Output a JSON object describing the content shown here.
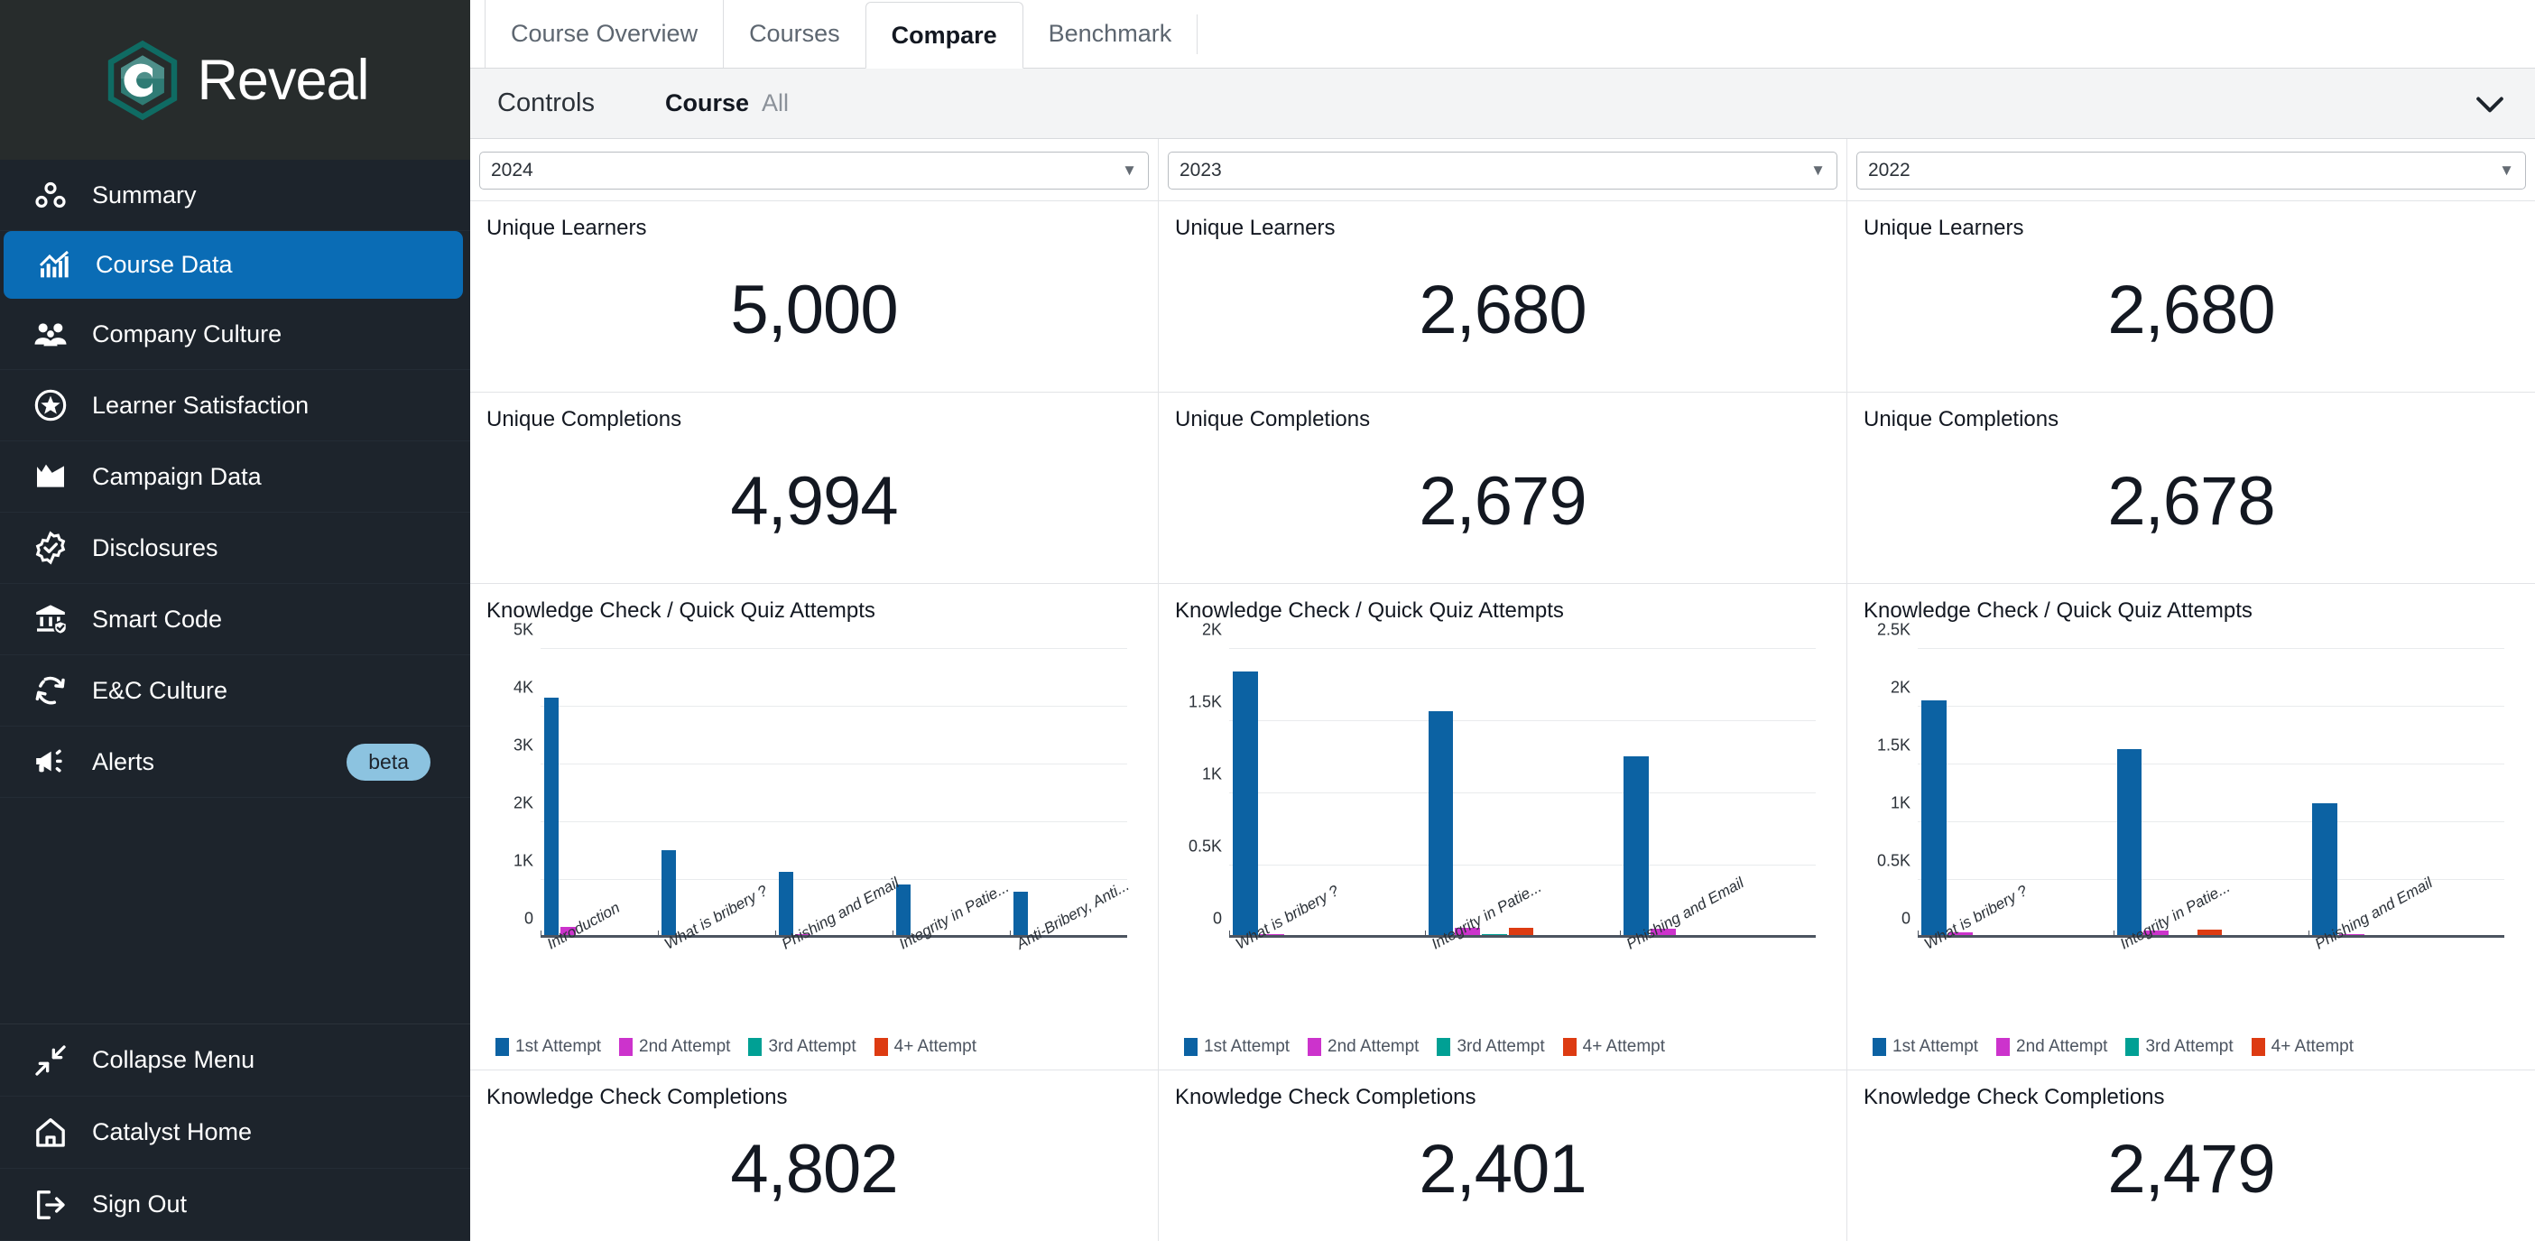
{
  "brand": {
    "name": "Reveal",
    "logo_icon": "reveal-hexagon-c-logo"
  },
  "sidebar": {
    "items": [
      {
        "label": "Summary",
        "icon": "dots-summary-icon",
        "active": false
      },
      {
        "label": "Course Data",
        "icon": "bar-chart-trend-icon",
        "active": true
      },
      {
        "label": "Company Culture",
        "icon": "people-group-icon",
        "active": false
      },
      {
        "label": "Learner Satisfaction",
        "icon": "star-circle-icon",
        "active": false
      },
      {
        "label": "Campaign Data",
        "icon": "image-mountain-icon",
        "active": false
      },
      {
        "label": "Disclosures",
        "icon": "badge-check-icon",
        "active": false
      },
      {
        "label": "Smart Code",
        "icon": "bank-shield-icon",
        "active": false
      },
      {
        "label": "E&C Culture",
        "icon": "refresh-cycle-icon",
        "active": false
      },
      {
        "label": "Alerts",
        "icon": "megaphone-icon",
        "active": false,
        "badge": "beta"
      }
    ],
    "bottom_items": [
      {
        "label": "Collapse Menu",
        "icon": "collapse-arrows-icon"
      },
      {
        "label": "Catalyst Home",
        "icon": "home-icon"
      },
      {
        "label": "Sign Out",
        "icon": "sign-out-icon"
      }
    ]
  },
  "tabs": [
    {
      "label": "Course Overview",
      "active": false
    },
    {
      "label": "Courses",
      "active": false
    },
    {
      "label": "Compare",
      "active": true
    },
    {
      "label": "Benchmark",
      "active": false
    }
  ],
  "controls": {
    "title": "Controls",
    "filter_key": "Course",
    "filter_value": "All",
    "chevron_icon": "chevron-down-icon"
  },
  "columns": [
    {
      "year_select": {
        "value": "2024",
        "caret_icon": "caret-down-icon"
      },
      "unique_learners": {
        "label": "Unique Learners",
        "value": "5,000"
      },
      "unique_completions": {
        "label": "Unique Completions",
        "value": "4,994"
      },
      "knowledge_check_completions": {
        "label": "Knowledge Check Completions",
        "value": "4,802"
      },
      "chart_index": 0
    },
    {
      "year_select": {
        "value": "2023",
        "caret_icon": "caret-down-icon"
      },
      "unique_learners": {
        "label": "Unique Learners",
        "value": "2,680"
      },
      "unique_completions": {
        "label": "Unique Completions",
        "value": "2,679"
      },
      "knowledge_check_completions": {
        "label": "Knowledge Check Completions",
        "value": "2,401"
      },
      "chart_index": 1
    },
    {
      "year_select": {
        "value": "2022",
        "caret_icon": "caret-down-icon"
      },
      "unique_learners": {
        "label": "Unique Learners",
        "value": "2,680"
      },
      "unique_completions": {
        "label": "Unique Completions",
        "value": "2,678"
      },
      "knowledge_check_completions": {
        "label": "Knowledge Check Completions",
        "value": "2,479"
      },
      "chart_index": 2
    }
  ],
  "series_colors": [
    "#0c62a3",
    "#cc33cc",
    "#00a094",
    "#dd3b12"
  ],
  "chart_data": [
    {
      "type": "bar",
      "title": "Knowledge Check / Quick Quiz Attempts",
      "xlabel": "",
      "ylabel": "",
      "ylim": [
        0,
        5000
      ],
      "yticks": [
        0,
        1000,
        2000,
        3000,
        4000,
        5000
      ],
      "ytick_labels": [
        "0",
        "1K",
        "2K",
        "3K",
        "4K",
        "5K"
      ],
      "grid": true,
      "legend_position": "bottom",
      "categories": [
        "Introduction",
        "What is bribery ?",
        "Phishing and Email",
        "Integrity in Patie...",
        "Anti-Bribery, Anti..."
      ],
      "series": [
        {
          "name": "1st Attempt",
          "values": [
            4160,
            1510,
            1135,
            915,
            800
          ]
        },
        {
          "name": "2nd Attempt",
          "values": [
            185,
            22,
            65,
            35,
            18
          ]
        },
        {
          "name": "3rd Attempt",
          "values": [
            35,
            8,
            10,
            12,
            6
          ]
        },
        {
          "name": "4+ Attempt",
          "values": [
            28,
            5,
            6,
            22,
            5
          ]
        }
      ]
    },
    {
      "type": "bar",
      "title": "Knowledge Check / Quick Quiz Attempts",
      "xlabel": "",
      "ylabel": "",
      "ylim": [
        0,
        2000
      ],
      "yticks": [
        0,
        500,
        1000,
        1500,
        2000
      ],
      "ytick_labels": [
        "0",
        "0.5K",
        "1K",
        "1.5K",
        "2K"
      ],
      "grid": true,
      "legend_position": "bottom",
      "categories": [
        "What is bribery ?",
        "Integrity in Patie...",
        "Phishing and Email"
      ],
      "series": [
        {
          "name": "1st Attempt",
          "values": [
            1845,
            1570,
            1255
          ]
        },
        {
          "name": "2nd Attempt",
          "values": [
            25,
            70,
            60
          ]
        },
        {
          "name": "3rd Attempt",
          "values": [
            5,
            25,
            12
          ]
        },
        {
          "name": "4+ Attempt",
          "values": [
            3,
            68,
            14
          ]
        }
      ]
    },
    {
      "type": "bar",
      "title": "Knowledge Check / Quick Quiz Attempts",
      "xlabel": "",
      "ylabel": "",
      "ylim": [
        0,
        2500
      ],
      "yticks": [
        0,
        500,
        1000,
        1500,
        2000,
        2500
      ],
      "ytick_labels": [
        "0",
        "0.5K",
        "1K",
        "1.5K",
        "2K",
        "2.5K"
      ],
      "grid": true,
      "legend_position": "bottom",
      "categories": [
        "What is bribery ?",
        "Integrity in Patie...",
        "Phishing and Email"
      ],
      "series": [
        {
          "name": "1st Attempt",
          "values": [
            2055,
            1630,
            1165
          ]
        },
        {
          "name": "2nd Attempt",
          "values": [
            45,
            65,
            35
          ]
        },
        {
          "name": "3rd Attempt",
          "values": [
            8,
            22,
            10
          ]
        },
        {
          "name": "4+ Attempt",
          "values": [
            10,
            70,
            12
          ]
        }
      ]
    }
  ],
  "chart_common": {
    "title": "Knowledge Check / Quick Quiz Attempts"
  }
}
